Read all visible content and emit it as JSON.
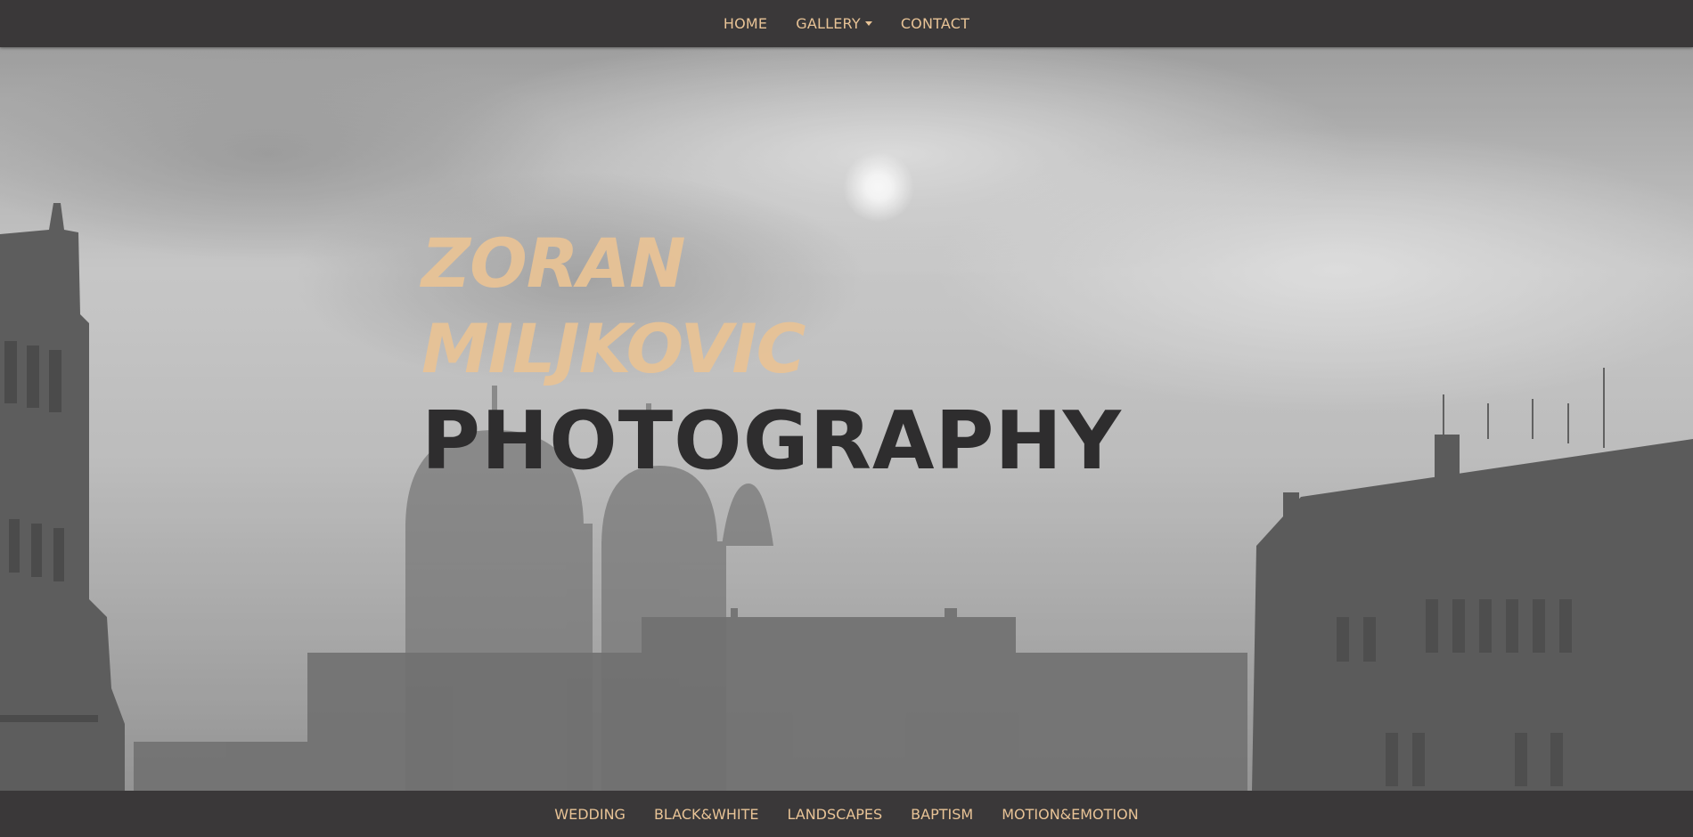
{
  "topnav": {
    "items": [
      {
        "label": "HOME"
      },
      {
        "label": "GALLERY",
        "has_dropdown": true
      },
      {
        "label": "CONTACT"
      }
    ]
  },
  "hero": {
    "name_line1": "ZORAN",
    "name_line2": "MILJKOVIC",
    "tagline": "PHOTOGRAPHY"
  },
  "categories": [
    {
      "label": "WEDDING"
    },
    {
      "label": "BLACK&WHITE"
    },
    {
      "label": "LANDSCAPES"
    },
    {
      "label": "BAPTISM"
    },
    {
      "label": "MOTION&EMOTION"
    }
  ],
  "colors": {
    "bar_background": "#3a3839",
    "accent": "#e8c396",
    "tagline": "#2e2d2e"
  }
}
